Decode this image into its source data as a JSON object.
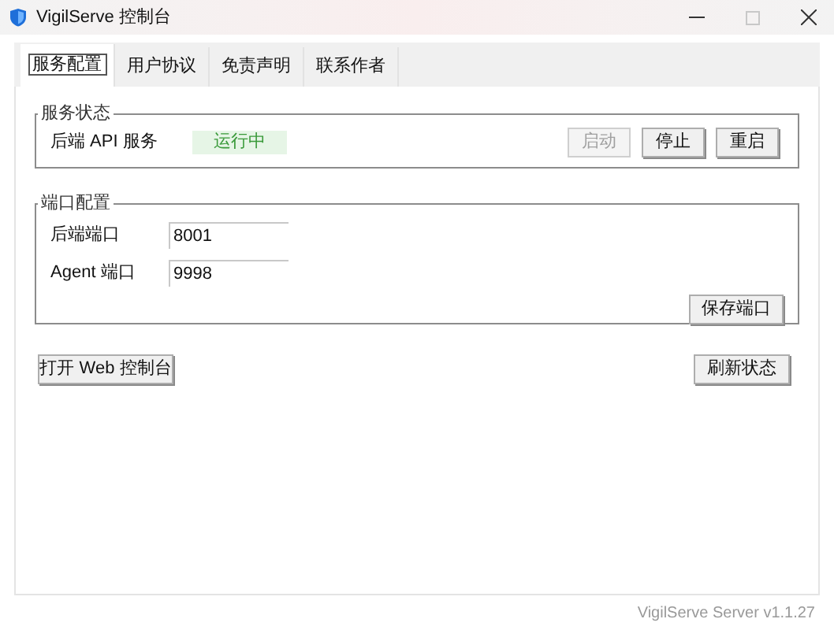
{
  "window": {
    "title": "VigilServe 控制台"
  },
  "tabs": [
    {
      "label": "服务配置",
      "selected": true
    },
    {
      "label": "用户协议",
      "selected": false
    },
    {
      "label": "免责声明",
      "selected": false
    },
    {
      "label": "联系作者",
      "selected": false
    }
  ],
  "service_status": {
    "title": "服务状态",
    "label": "后端 API 服务",
    "status": "运行中",
    "running": true,
    "buttons": [
      {
        "label": "启动",
        "disabled": true
      },
      {
        "label": "停止",
        "disabled": false
      },
      {
        "label": "重启",
        "disabled": false
      }
    ]
  },
  "port_config": {
    "title": "端口配置",
    "fields": [
      {
        "label": "后端端口",
        "value": "8001"
      },
      {
        "label": "Agent 端口",
        "value": "9998"
      }
    ],
    "save_button": "保存端口"
  },
  "open_web_button": "打开 Web 控制台",
  "refresh_button": "刷新状态",
  "status_bar": "VigilServe Server v1.1.27"
}
